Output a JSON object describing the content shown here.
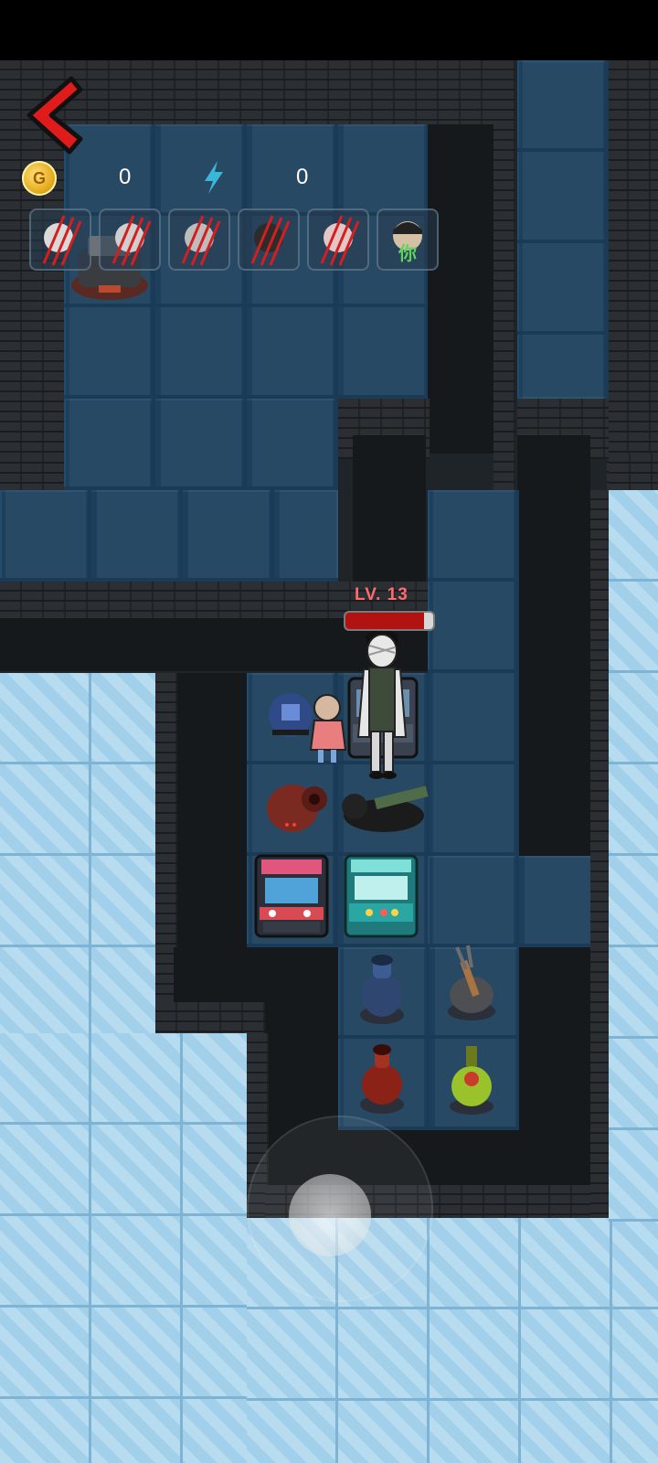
{
  "hud": {
    "back_icon": "back-chevron-icon",
    "coins": {
      "icon": "gold-coin-icon",
      "icon_letter": "G",
      "value": "0"
    },
    "energy": {
      "icon": "lightning-bolt-icon",
      "value": "0"
    }
  },
  "players": [
    {
      "status": "clawed"
    },
    {
      "status": "clawed"
    },
    {
      "status": "clawed"
    },
    {
      "status": "clawed"
    },
    {
      "status": "clawed"
    },
    {
      "status": "self",
      "label": "你"
    }
  ],
  "character": {
    "level_label": "LV. 13",
    "hp_fraction": 0.9
  },
  "objects": [
    "arcade-machine",
    "arcade-machine",
    "sleeping-dog",
    "speaker-turret",
    "blue-vase-turret",
    "red-vase-turret",
    "fork-turret",
    "green-potion-turret",
    "trap-robot"
  ],
  "colors": {
    "accent_red": "#e01b1b",
    "hp_red": "#b11313",
    "floor_blue": "#2e5f86",
    "ice": "#a9d4ec"
  }
}
